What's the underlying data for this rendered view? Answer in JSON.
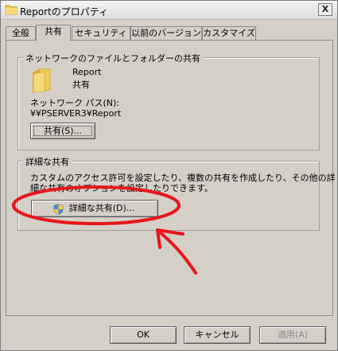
{
  "window": {
    "title": "Reportのプロパティ",
    "close_label": "X"
  },
  "tabs": [
    {
      "label": "全般",
      "active": false
    },
    {
      "label": "共有",
      "active": true
    },
    {
      "label": "セキュリティ",
      "active": false
    },
    {
      "label": "以前のバージョン",
      "active": false
    },
    {
      "label": "カスタマイズ",
      "active": false
    }
  ],
  "network_share": {
    "legend": "ネットワークのファイルとフォルダーの共有",
    "folder_name": "Report",
    "folder_state": "共有",
    "path_label": "ネットワーク パス(N):",
    "path_value": "¥¥PSERVER3¥Report",
    "share_button": "共有(S)..."
  },
  "advanced_share": {
    "legend": "詳細な共有",
    "description_line1": "カスタムのアクセス許可を設定したり、複数の共有を作成したり、その他の詳",
    "description_line2": "細な共有のオプションを設定したりできます。",
    "button": "詳細な共有(D)..."
  },
  "footer": {
    "ok": "OK",
    "cancel": "キャンセル",
    "apply": "適用(A)"
  },
  "colors": {
    "annotation": "#e8161c",
    "folder": "#f2c94c",
    "dialog_face": "#d4d0c8"
  }
}
